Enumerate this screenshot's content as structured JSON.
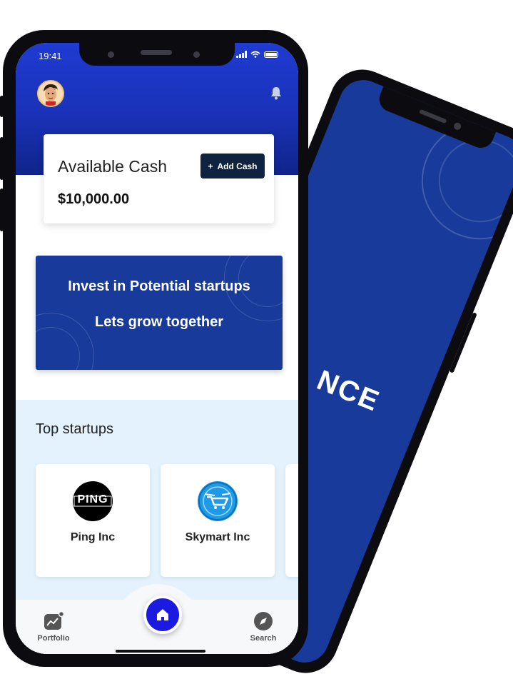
{
  "status_bar": {
    "time": "19:41"
  },
  "cash": {
    "label": "Available Cash",
    "value": "$10,000.00",
    "add_button_label": "Add Cash",
    "add_button_icon": "plus-icon"
  },
  "promo": {
    "line1": "Invest in Potential startups",
    "line2": "Lets grow together"
  },
  "top_startups": {
    "title": "Top startups",
    "items": [
      {
        "name": "Ping Inc",
        "logo_text": "PING",
        "logo_bg": "#000000"
      },
      {
        "name": "Skymart Inc",
        "logo_bg": "#1e9be8",
        "icon": "shopping-cart-icon"
      }
    ]
  },
  "tabbar": {
    "items": [
      {
        "label": "Portfolio",
        "icon": "chart-icon"
      },
      {
        "label": "",
        "icon": "home-icon"
      },
      {
        "label": "Search",
        "icon": "compass-icon"
      }
    ]
  },
  "back_phone": {
    "text": "NCE"
  },
  "colors": {
    "primary": "#1a1ae0",
    "hero": "#1f3bd1",
    "navy": "#183a9a",
    "button_dark": "#0f2340",
    "startups_bg": "#e3f2fd"
  }
}
